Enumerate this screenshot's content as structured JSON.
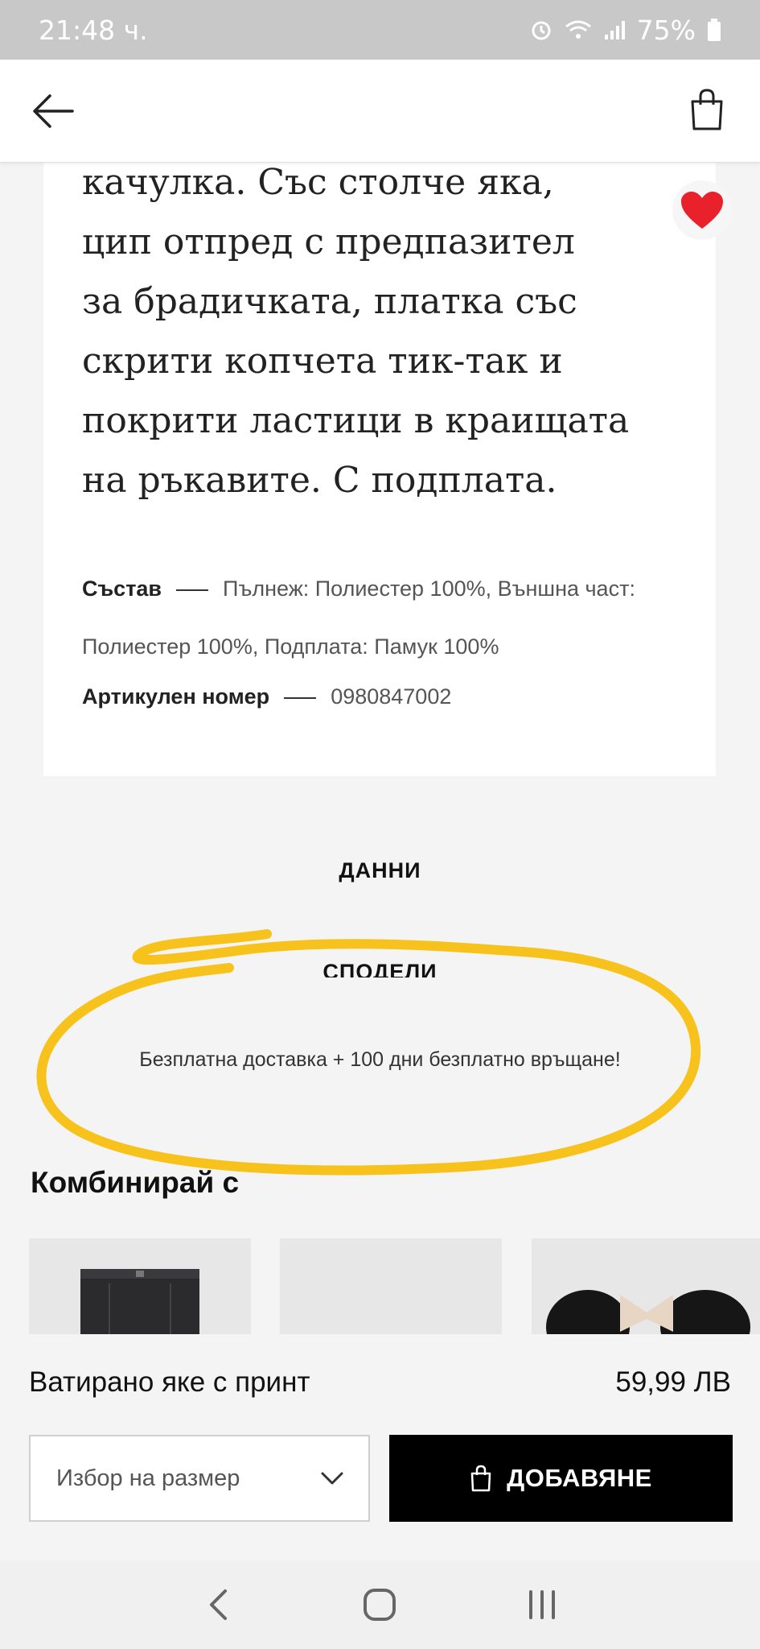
{
  "status_bar": {
    "time": "21:48 ч.",
    "battery": "75%"
  },
  "description": {
    "lines": [
      "качулка. Със столче яка,",
      "цип отпред с предпазител",
      "за брадичката, платка със",
      "скрити копчета тик-так и",
      "покрити ластици в краищата",
      "на ръкавите. С подплата."
    ],
    "composition_label": "Състав",
    "composition_value": "Пълнеж: Полиестер 100%, Външна част: Полиестер 100%, Подплата: Памук 100%",
    "article_label": "Артикулен номер",
    "article_value": "0980847002"
  },
  "links": {
    "data": "ДАННИ",
    "share": "СПОДЕЛИ"
  },
  "promo": "Безплатна доставка + 100 дни безплатно връщане!",
  "combine": {
    "title": "Комбинирай с"
  },
  "product": {
    "name": "Ватирано яке с принт",
    "price": "59,99 ЛВ",
    "size_placeholder": "Избор на размер",
    "add_label": "ДОБАВЯНЕ"
  },
  "colors": {
    "accent_highlight": "#f7c21b",
    "favorite": "#e8212b",
    "button_bg": "#000000"
  },
  "icons": [
    "back-arrow-icon",
    "shopping-bag-icon",
    "heart-icon",
    "chevron-down-icon",
    "nav-back-icon",
    "nav-home-icon",
    "nav-recents-icon"
  ]
}
